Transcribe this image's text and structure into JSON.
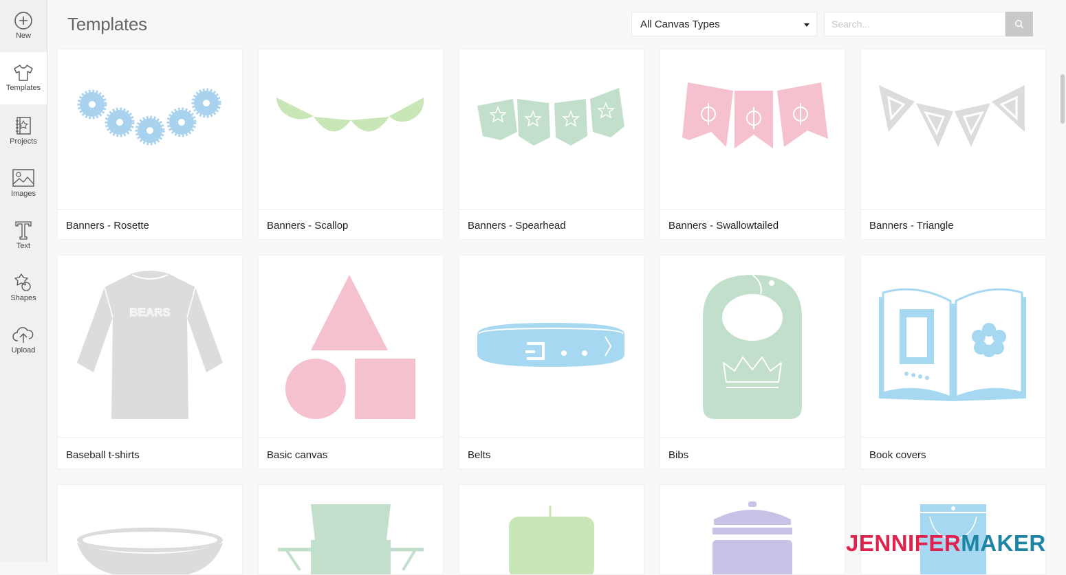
{
  "sidebar": {
    "items": [
      {
        "label": "New",
        "icon": "plus-circle-icon"
      },
      {
        "label": "Templates",
        "icon": "tshirt-icon"
      },
      {
        "label": "Projects",
        "icon": "book-icon"
      },
      {
        "label": "Images",
        "icon": "image-icon"
      },
      {
        "label": "Text",
        "icon": "text-icon"
      },
      {
        "label": "Shapes",
        "icon": "shapes-icon"
      },
      {
        "label": "Upload",
        "icon": "cloud-upload-icon"
      }
    ],
    "active": "Templates"
  },
  "header": {
    "title": "Templates",
    "canvas_filter": "All Canvas Types",
    "search_placeholder": "Search..."
  },
  "templates": [
    {
      "name": "Banners - Rosette",
      "icon": "rosette-banner",
      "color": "#a9d2ee"
    },
    {
      "name": "Banners - Scallop",
      "icon": "scallop-banner",
      "color": "#c8e6b6"
    },
    {
      "name": "Banners - Spearhead",
      "icon": "spearhead-banner",
      "color": "#c2dfcb"
    },
    {
      "name": "Banners - Swallowtailed",
      "icon": "swallowtail-banner",
      "color": "#f5c1cf"
    },
    {
      "name": "Banners - Triangle",
      "icon": "triangle-banner",
      "color": "#dcdcdc"
    },
    {
      "name": "Baseball t-shirts",
      "icon": "baseball-tshirt",
      "color": "#dcdcdc"
    },
    {
      "name": "Basic canvas",
      "icon": "basic-shapes",
      "color": "#f5c1cf"
    },
    {
      "name": "Belts",
      "icon": "belt",
      "color": "#a7d8f1"
    },
    {
      "name": "Bibs",
      "icon": "bib",
      "color": "#c2dfcb"
    },
    {
      "name": "Book covers",
      "icon": "open-book",
      "color": "#a7d8f1"
    },
    {
      "name": "",
      "icon": "bowl",
      "color": "#dcdcdc"
    },
    {
      "name": "",
      "icon": "camp-chair",
      "color": "#c2dfcb"
    },
    {
      "name": "",
      "icon": "candle",
      "color": "#c8e6b6"
    },
    {
      "name": "",
      "icon": "canister",
      "color": "#c9c1e6"
    },
    {
      "name": "",
      "icon": "jeans",
      "color": "#a7d8f1"
    }
  ],
  "thumb_text": {
    "bears": "BEARS"
  },
  "watermark": {
    "part1": "JENNIFER",
    "part2": "MAKER"
  }
}
